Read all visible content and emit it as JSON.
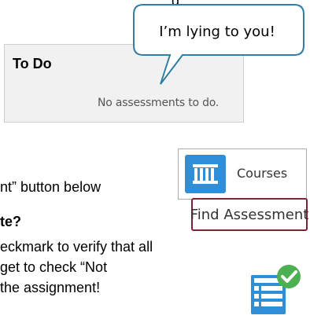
{
  "top_text": "g",
  "bubble": {
    "text": "I’m lying to you!"
  },
  "todo_panel": {
    "title": "To Do",
    "empty_message": "No assessments to do."
  },
  "courses_button": {
    "label": "Courses",
    "icon": "courses-icon",
    "color": "#2e8fd8"
  },
  "body_lines": {
    "line1": "nt” button below",
    "line2": "te?",
    "line3": "eckmark to verify that all",
    "line4": "get to check “Not",
    "line5": "the assignment!"
  },
  "find_button": {
    "label": "Find Assessment",
    "border_color": "#7b2234"
  },
  "checklist_icon": {
    "icon": "checklist-checkmark-icon",
    "color": "#2e8fd8",
    "check_color": "#4caf50"
  }
}
